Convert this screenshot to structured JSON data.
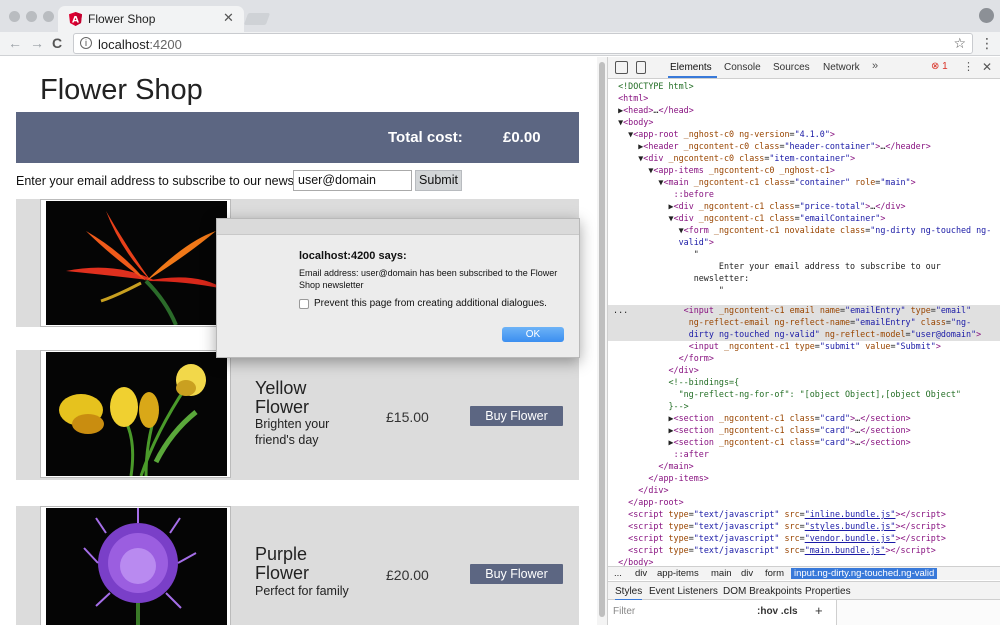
{
  "browser": {
    "tab_title": "Flower Shop",
    "url_host": "localhost",
    "url_port": ":4200",
    "close_glyph": "✕",
    "back_glyph": "←",
    "forward_glyph": "→",
    "reload_glyph": "C",
    "star_glyph": "☆",
    "menu_glyph": "⋮",
    "info_glyph": "i"
  },
  "page": {
    "title": "Flower Shop",
    "total_label": "Total cost:",
    "total_value": "£0.00",
    "newsletter_label": "Enter your email address to subscribe to our newsletter:",
    "email_value": "user@domain",
    "submit_label": "Submit",
    "cards": [
      {
        "name": "",
        "desc": "",
        "price": "",
        "button": ""
      },
      {
        "name": "Yellow Flower",
        "desc": "Brighten your friend's day",
        "price": "£15.00",
        "button": "Buy Flower"
      },
      {
        "name": "Purple Flower",
        "desc": "Perfect for family",
        "price": "£20.00",
        "button": "Buy Flower"
      }
    ]
  },
  "dialog": {
    "title": "localhost:4200 says:",
    "message": "Email address: user@domain has been subscribed to the Flower Shop newsletter",
    "checkbox_label": "Prevent this page from creating additional dialogues.",
    "ok_label": "OK"
  },
  "devtools": {
    "tabs": [
      "Elements",
      "Console",
      "Sources",
      "Network"
    ],
    "more_glyph": "»",
    "error_count": "⊗ 1",
    "kebab_glyph": "⋮",
    "close_glyph": "✕",
    "breadcrumbs": [
      "...",
      "div",
      "app-items",
      "main",
      "div",
      "form",
      "input.ng-dirty.ng-touched.ng-valid"
    ],
    "subtabs": [
      "Styles",
      "Event Listeners",
      "DOM Breakpoints",
      "Properties"
    ],
    "filter_placeholder": "Filter",
    "filter_hov": ":hov .cls",
    "filter_plus": "+"
  },
  "colors": {
    "header_bar": "#5c6682",
    "card_bg": "#dcdcdc",
    "devtools_accent": "#3879d9"
  }
}
